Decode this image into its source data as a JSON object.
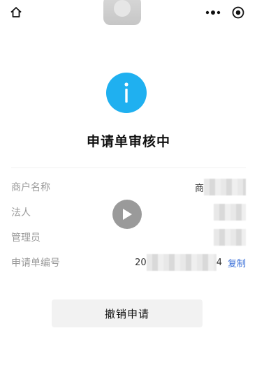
{
  "nav": {
    "home_icon": "home-icon",
    "more_icon": "more-dots-icon",
    "close_icon": "target-icon"
  },
  "status": {
    "icon": "info-icon",
    "icon_color": "#1fb0f0",
    "title": "申请单审核中"
  },
  "info": {
    "merchant_name": {
      "label": "商户名称",
      "value_prefix": "商"
    },
    "legal_person": {
      "label": "法人"
    },
    "manager": {
      "label": "管理员"
    },
    "application_no": {
      "label": "申请单编号",
      "value_start": "20",
      "value_end": "4",
      "copy_label": "复制"
    }
  },
  "overlay": {
    "play_icon": "play-icon"
  },
  "actions": {
    "cancel_label": "撤销申请"
  },
  "colors": {
    "link": "#3a6fd8",
    "label": "#9a9a9a",
    "button_bg": "#f2f2f2"
  }
}
